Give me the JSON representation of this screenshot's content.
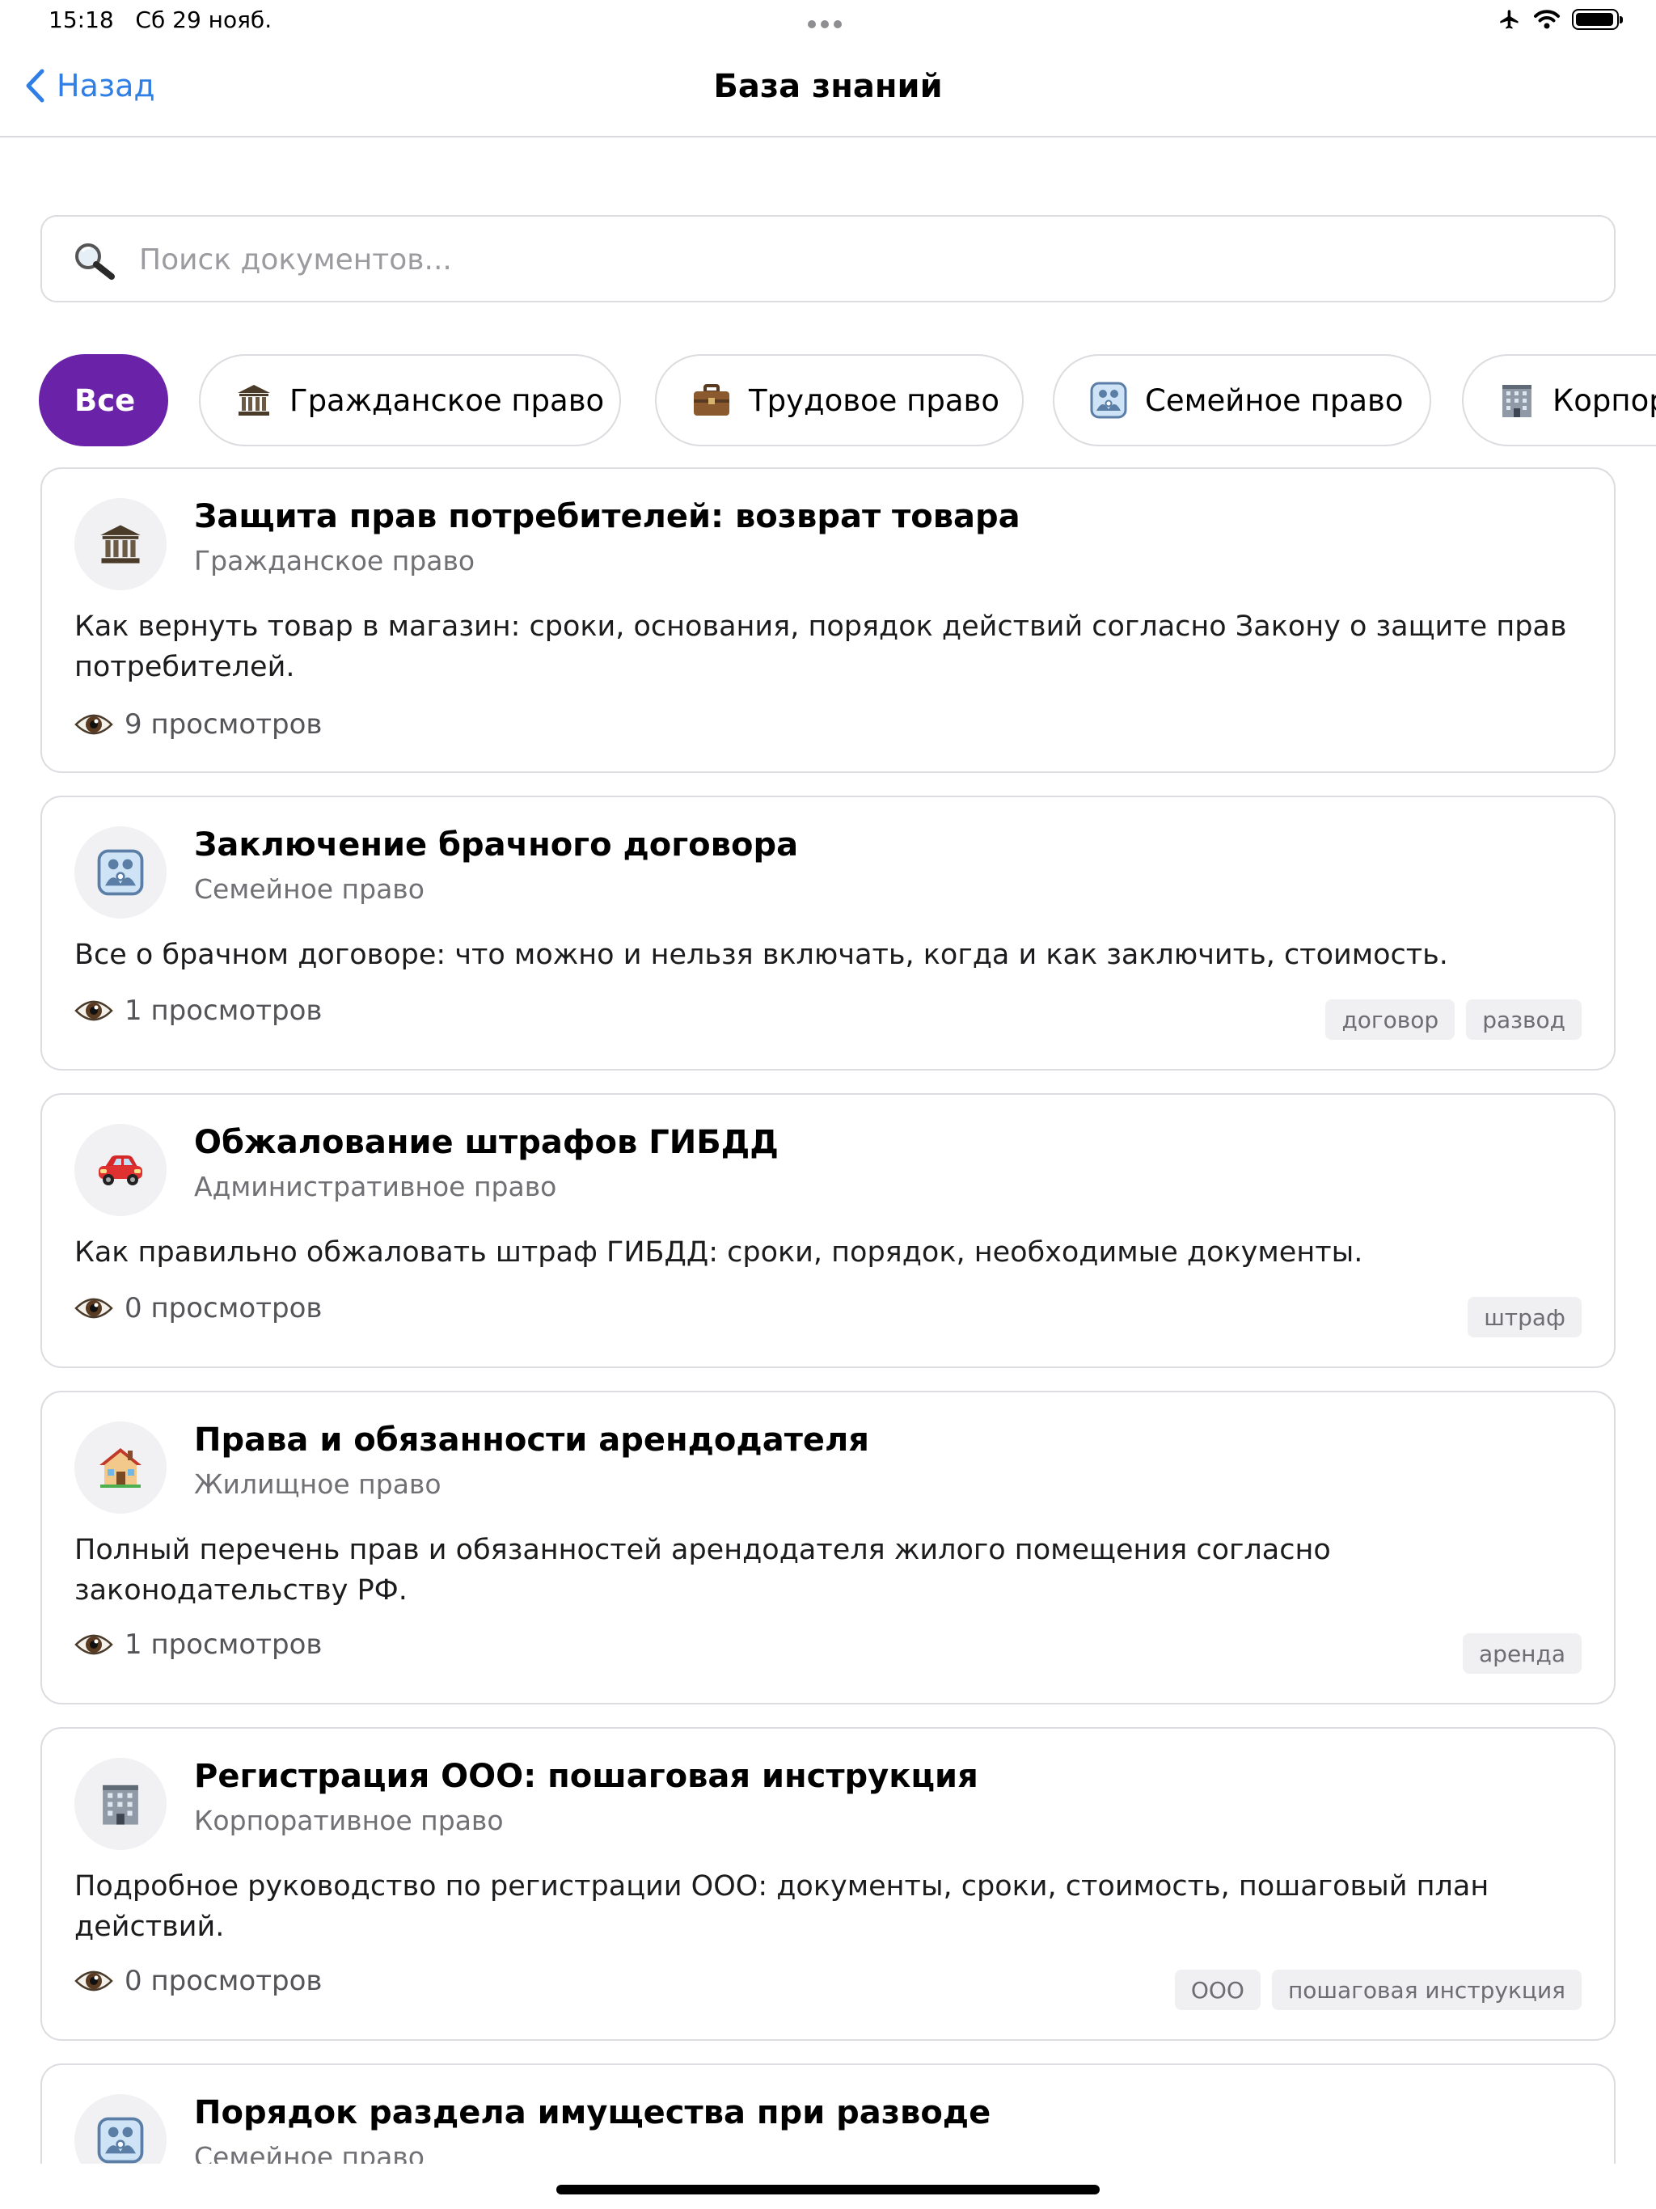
{
  "status": {
    "time": "15:18",
    "date": "Сб 29 нояб.",
    "battery_level": 0.95
  },
  "nav": {
    "back_label": "Назад",
    "title": "База знаний"
  },
  "search": {
    "placeholder": "Поиск документов...",
    "value": ""
  },
  "chips": [
    {
      "label": "Все",
      "icon": "",
      "active": true
    },
    {
      "label": "Гражданское право",
      "icon": "classical-building-icon",
      "active": false
    },
    {
      "label": "Трудовое право",
      "icon": "briefcase-icon",
      "active": false
    },
    {
      "label": "Семейное право",
      "icon": "family-icon",
      "active": false
    },
    {
      "label": "Корпор",
      "icon": "office-building-icon",
      "active": false
    }
  ],
  "cards": [
    {
      "icon": "classical-building-icon",
      "title": "Защита прав потребителей: возврат товара",
      "category": "Гражданское право",
      "description": "Как вернуть товар в магазин: сроки, основания, порядок действий согласно Закону о защите прав потребителей.",
      "views": "9 просмотров",
      "tags": []
    },
    {
      "icon": "family-icon",
      "title": "Заключение брачного договора",
      "category": "Семейное право",
      "description": "Все о брачном договоре: что можно и нельзя включать, когда и как заключить, стоимость.",
      "views": "1 просмотров",
      "tags": [
        "договор",
        "развод"
      ]
    },
    {
      "icon": "car-icon",
      "title": "Обжалование штрафов ГИБДД",
      "category": "Административное право",
      "description": "Как правильно обжаловать штраф ГИБДД: сроки, порядок, необходимые документы.",
      "views": "0 просмотров",
      "tags": [
        "штраф"
      ]
    },
    {
      "icon": "house-icon",
      "title": "Права и обязанности арендодателя",
      "category": "Жилищное право",
      "description": "Полный перечень прав и обязанностей арендодателя жилого помещения согласно законодательству РФ.",
      "views": "1 просмотров",
      "tags": [
        "аренда"
      ]
    },
    {
      "icon": "office-building-icon",
      "title": "Регистрация ООО: пошаговая инструкция",
      "category": "Корпоративное право",
      "description": "Подробное руководство по регистрации ООО: документы, сроки, стоимость, пошаговый план действий.",
      "views": "0 просмотров",
      "tags": [
        "ООО",
        "пошаговая инструкция"
      ]
    },
    {
      "icon": "family-icon",
      "title": "Порядок раздела имущества при разводе",
      "category": "Семейное право",
      "description": "",
      "views": "",
      "tags": []
    }
  ]
}
